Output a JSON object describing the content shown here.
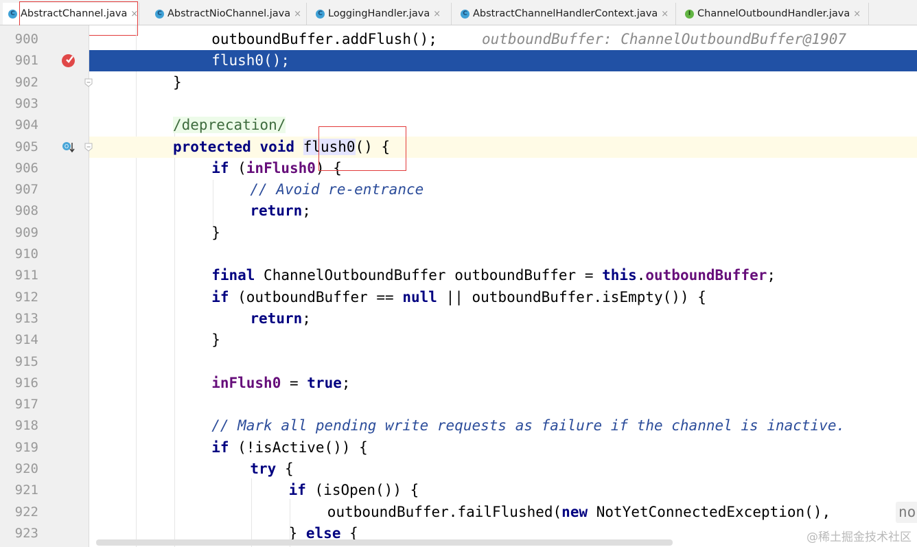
{
  "tabs": [
    {
      "label": "AbstractChannel.java",
      "icon": "class-icon",
      "active": true
    },
    {
      "label": "AbstractNioChannel.java",
      "icon": "class-icon",
      "active": false
    },
    {
      "label": "LoggingHandler.java",
      "icon": "class-icon",
      "active": false
    },
    {
      "label": "AbstractChannelHandlerContext.java",
      "icon": "class-icon",
      "active": false
    },
    {
      "label": "ChannelOutboundHandler.java",
      "icon": "interface-icon",
      "active": false
    }
  ],
  "tab_icon_letters": {
    "class": "C",
    "interface": "I"
  },
  "tab_close_glyph": "×",
  "editor": {
    "lines": [
      {
        "num": "900",
        "code": "outboundBuffer.addFlush();",
        "hint": "outboundBuffer: ChannelOutboundBuffer@1907"
      },
      {
        "num": "901",
        "code": "flush0();"
      },
      {
        "num": "902",
        "code": "}"
      },
      {
        "num": "903",
        "code": ""
      },
      {
        "num": "904",
        "code": "/deprecation/"
      },
      {
        "num": "905",
        "code": "protected void flush0() {"
      },
      {
        "num": "906",
        "code": "if (inFlush0) {"
      },
      {
        "num": "907",
        "code": "// Avoid re-entrance"
      },
      {
        "num": "908",
        "code": "return;"
      },
      {
        "num": "909",
        "code": "}"
      },
      {
        "num": "910",
        "code": ""
      },
      {
        "num": "911",
        "code": "final ChannelOutboundBuffer outboundBuffer = this.outboundBuffer;"
      },
      {
        "num": "912",
        "code": "if (outboundBuffer == null || outboundBuffer.isEmpty()) {"
      },
      {
        "num": "913",
        "code": "return;"
      },
      {
        "num": "914",
        "code": "}"
      },
      {
        "num": "915",
        "code": ""
      },
      {
        "num": "916",
        "code": "inFlush0 = true;"
      },
      {
        "num": "917",
        "code": ""
      },
      {
        "num": "918",
        "code": "// Mark all pending write requests as failure if the channel is inactive."
      },
      {
        "num": "919",
        "code": "if (!isActive()) {"
      },
      {
        "num": "920",
        "code": "try {"
      },
      {
        "num": "921",
        "code": "if (isOpen()) {"
      },
      {
        "num": "922",
        "code": "outboundBuffer.failFlushed(new NotYetConnectedException(),",
        "param_hint": "no"
      },
      {
        "num": "923",
        "code": "} else {"
      }
    ]
  },
  "colors": {
    "keyword": "#000080",
    "field": "#660e7a",
    "comment": "#2b4c9a",
    "selection": "#2151a5",
    "breakpoint": "#e04848"
  },
  "watermark": "@稀土掘金技术社区"
}
